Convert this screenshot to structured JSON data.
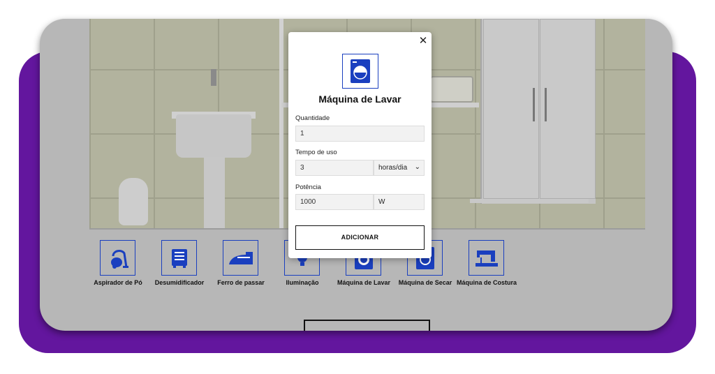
{
  "modal": {
    "title": "Máquina de Lavar",
    "icon": "washing-machine-icon",
    "close_label": "✕",
    "fields": {
      "quantity": {
        "label": "Quantidade",
        "value": "1"
      },
      "usage_time": {
        "label": "Tempo de uso",
        "value": "3",
        "unit": "horas/dia"
      },
      "power": {
        "label": "Potência",
        "value": "1000",
        "unit": "W"
      }
    },
    "add_button": "ADICIONAR"
  },
  "appliances": [
    {
      "label": "Aspirador de Pó",
      "icon": "vacuum-cleaner-icon"
    },
    {
      "label": "Desumidificador",
      "icon": "dehumidifier-icon"
    },
    {
      "label": "Ferro de passar",
      "icon": "iron-icon"
    },
    {
      "label": "Iluminação",
      "icon": "light-bulb-icon"
    },
    {
      "label": "Máquina de Lavar",
      "icon": "washing-machine-icon"
    },
    {
      "label": "Máquina de Secar",
      "icon": "dryer-icon"
    },
    {
      "label": "Máquina de Costura",
      "icon": "sewing-machine-icon"
    }
  ],
  "colors": {
    "accent_purple": "#63169e",
    "icon_blue": "#1a3fbf",
    "overlay_gray": "#b7b7b7"
  }
}
